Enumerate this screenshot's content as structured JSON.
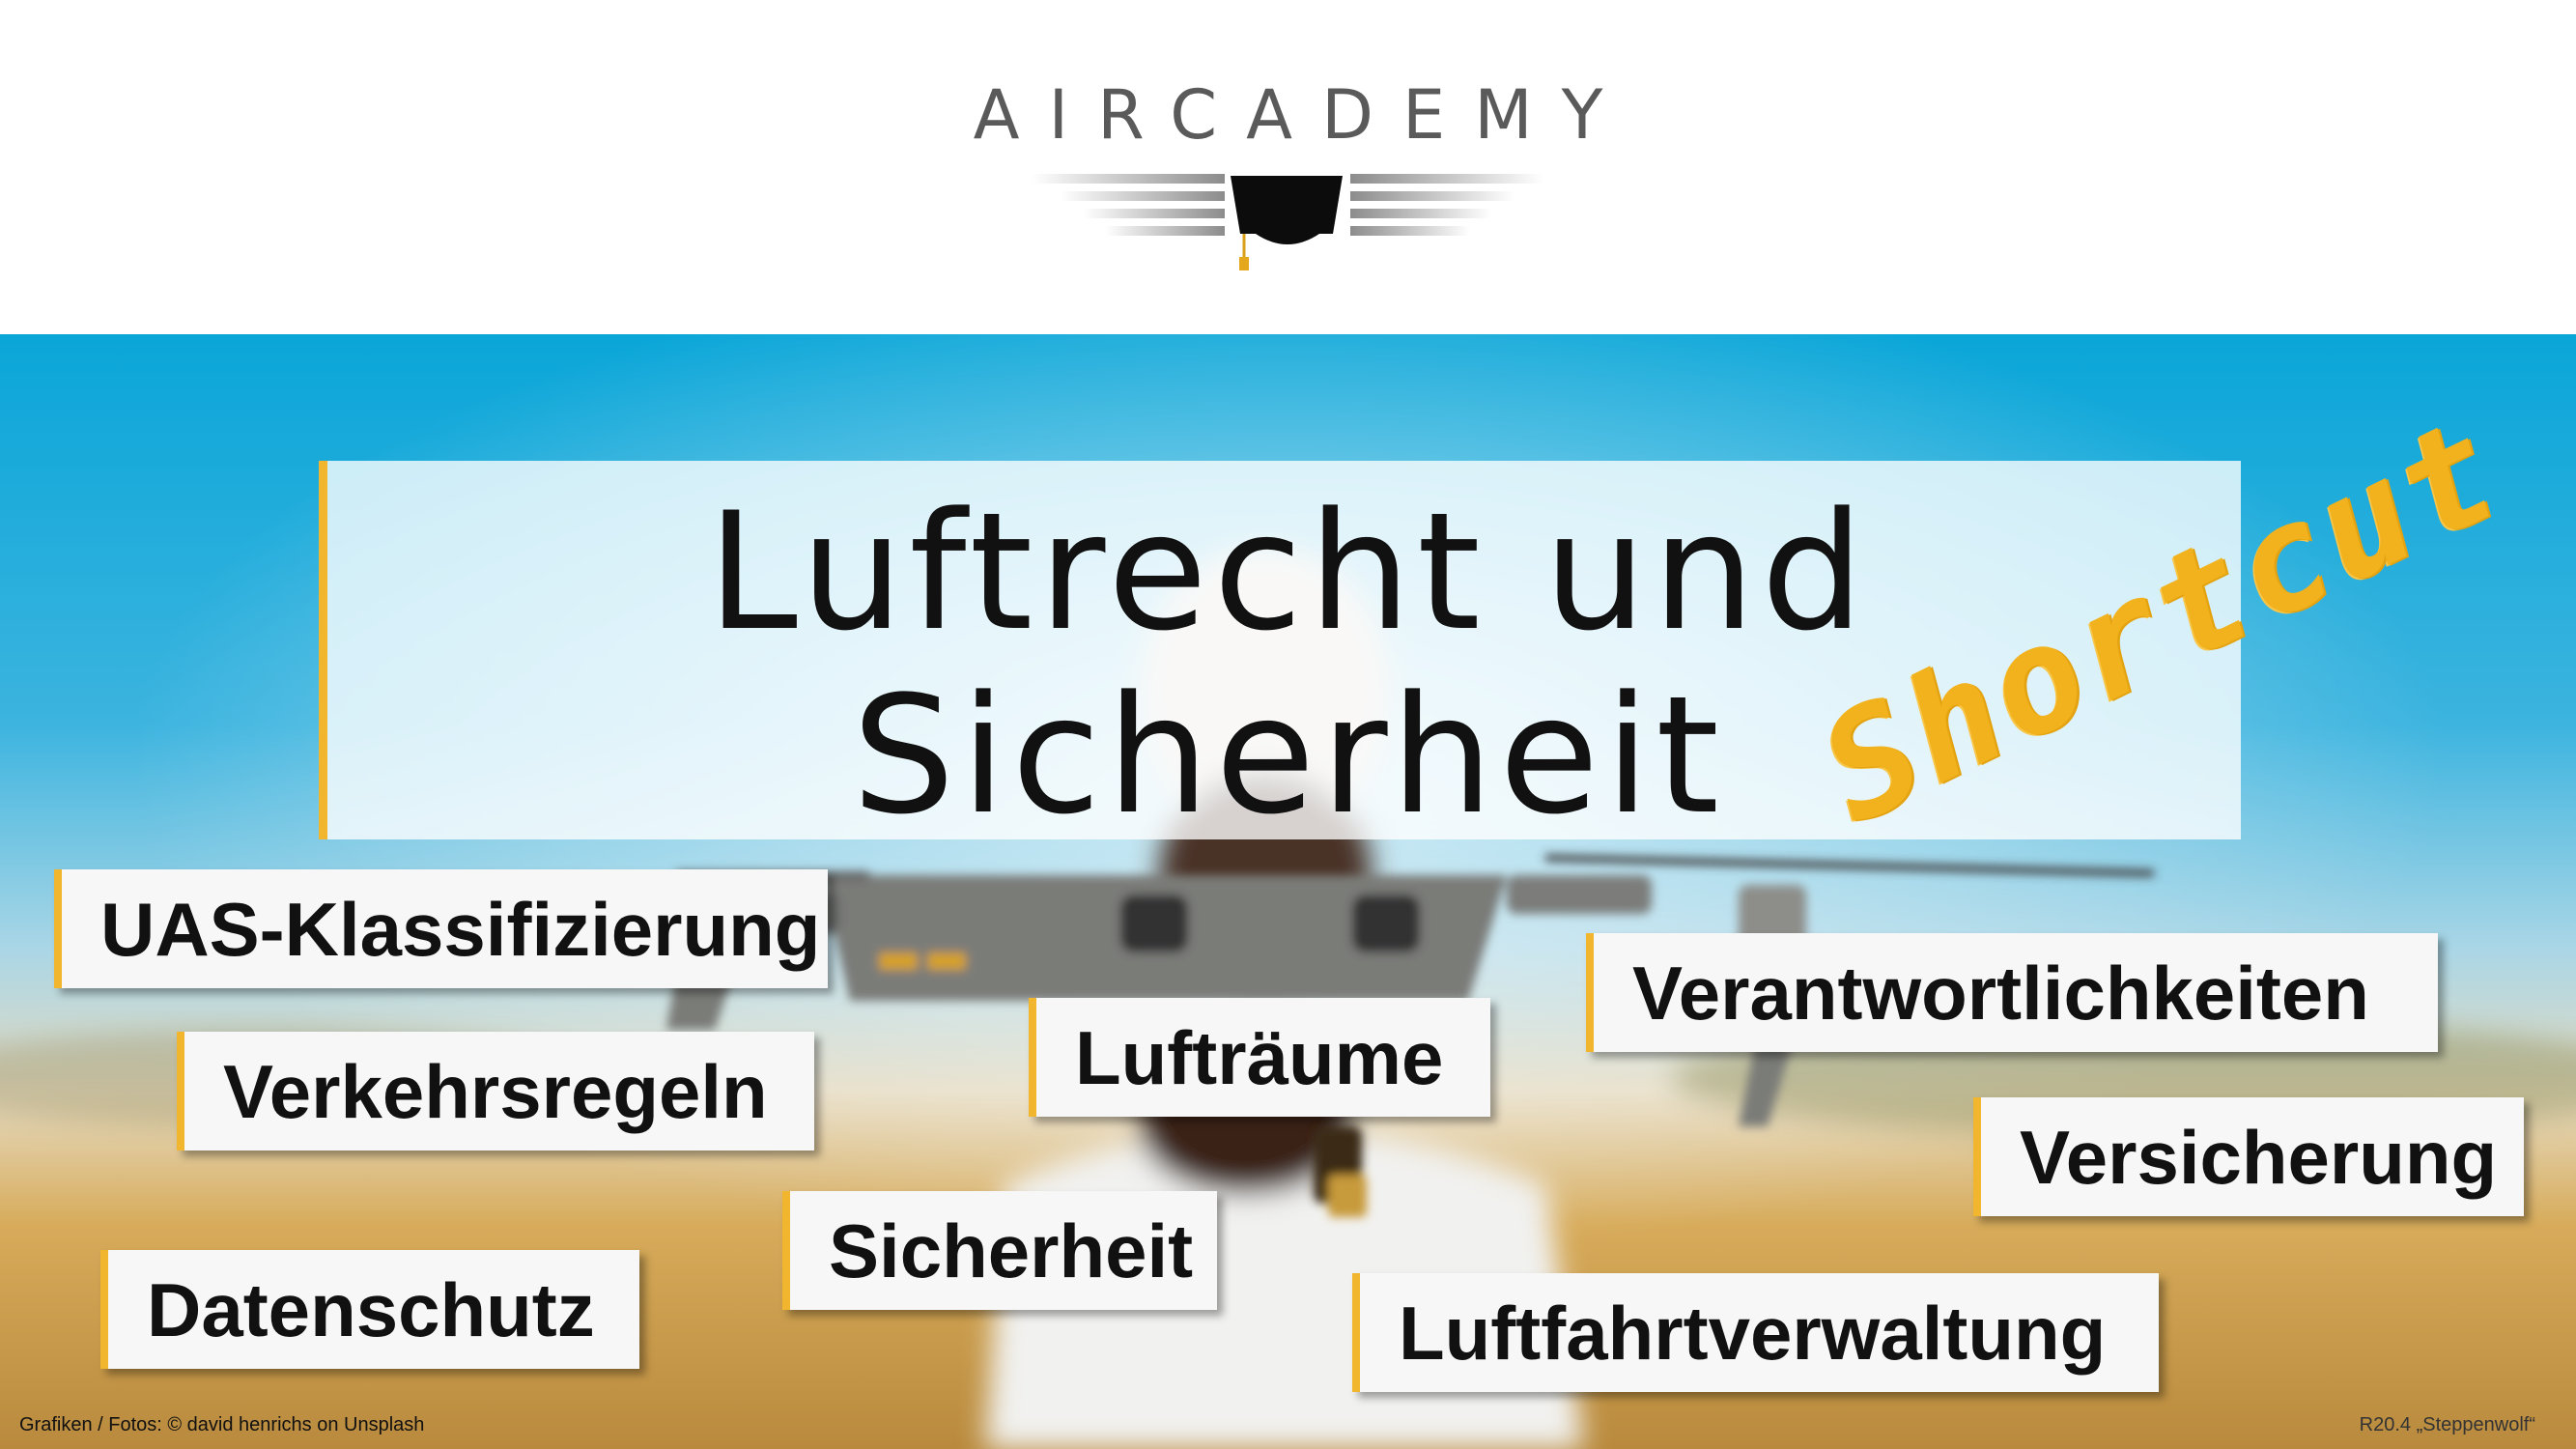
{
  "brand": {
    "name": "AIRCADEMY",
    "logo_icon": "mortarboard-wings-icon"
  },
  "title": {
    "line1": "Luftrecht und",
    "line2": "Sicherheit",
    "stamp": "Shortcut"
  },
  "topics": [
    "UAS-Klassifizierung",
    "Verkehrsregeln",
    "Lufträume",
    "Verantwortlichkeiten",
    "Versicherung",
    "Sicherheit",
    "Datenschutz",
    "Luftfahrtverwaltung"
  ],
  "footer": {
    "credit": "Grafiken / Fotos: © david henrichs on Unsplash",
    "version": "R20.4 „Steppenwolf“"
  },
  "colors": {
    "accent": "#f1b52e",
    "stamp": "#f2b21e",
    "brand_text": "#5a5a5a",
    "sky": "#1aa3d6",
    "field": "#d9a94f"
  }
}
